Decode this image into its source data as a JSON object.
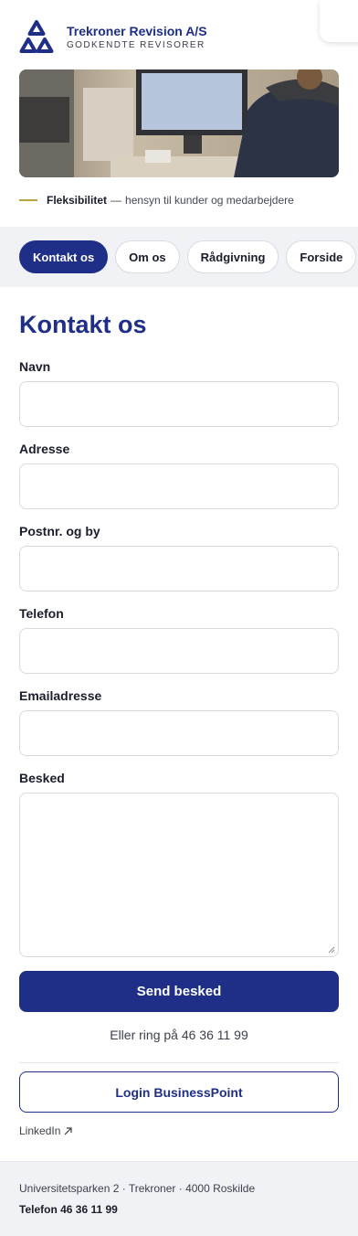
{
  "brand": {
    "name": "Trekroner Revision A/S",
    "subtitle": "GODKENDTE REVISORER"
  },
  "tagline": {
    "bold": "Fleksibilitet",
    "dash": "—",
    "rest": "hensyn til kunder og medarbejdere"
  },
  "nav": {
    "items": [
      {
        "label": "Kontakt os",
        "active": true
      },
      {
        "label": "Om os",
        "active": false
      },
      {
        "label": "Rådgivning",
        "active": false
      },
      {
        "label": "Forside",
        "active": false
      }
    ]
  },
  "form": {
    "title": "Kontakt os",
    "fields": [
      {
        "label": "Navn",
        "value": "",
        "placeholder": ""
      },
      {
        "label": "Adresse",
        "value": "",
        "placeholder": ""
      },
      {
        "label": "Postnr. og by",
        "value": "",
        "placeholder": ""
      },
      {
        "label": "Telefon",
        "value": "",
        "placeholder": ""
      },
      {
        "label": "Emailadresse",
        "value": "",
        "placeholder": ""
      },
      {
        "label": "Besked",
        "value": "",
        "placeholder": ""
      }
    ],
    "submit_label": "Send besked",
    "call_text": "Eller ring på 46 36 11 99"
  },
  "login_label": "Login BusinessPoint",
  "linkedin_label": "LinkedIn",
  "footer": {
    "address": "Universitetsparken 2 · Trekroner · 4000 Roskilde",
    "phone": "Telefon 46 36 11 99"
  },
  "colors": {
    "primary": "#1f2f88",
    "accent": "#b5a642",
    "background_soft": "#f1f2f6"
  }
}
